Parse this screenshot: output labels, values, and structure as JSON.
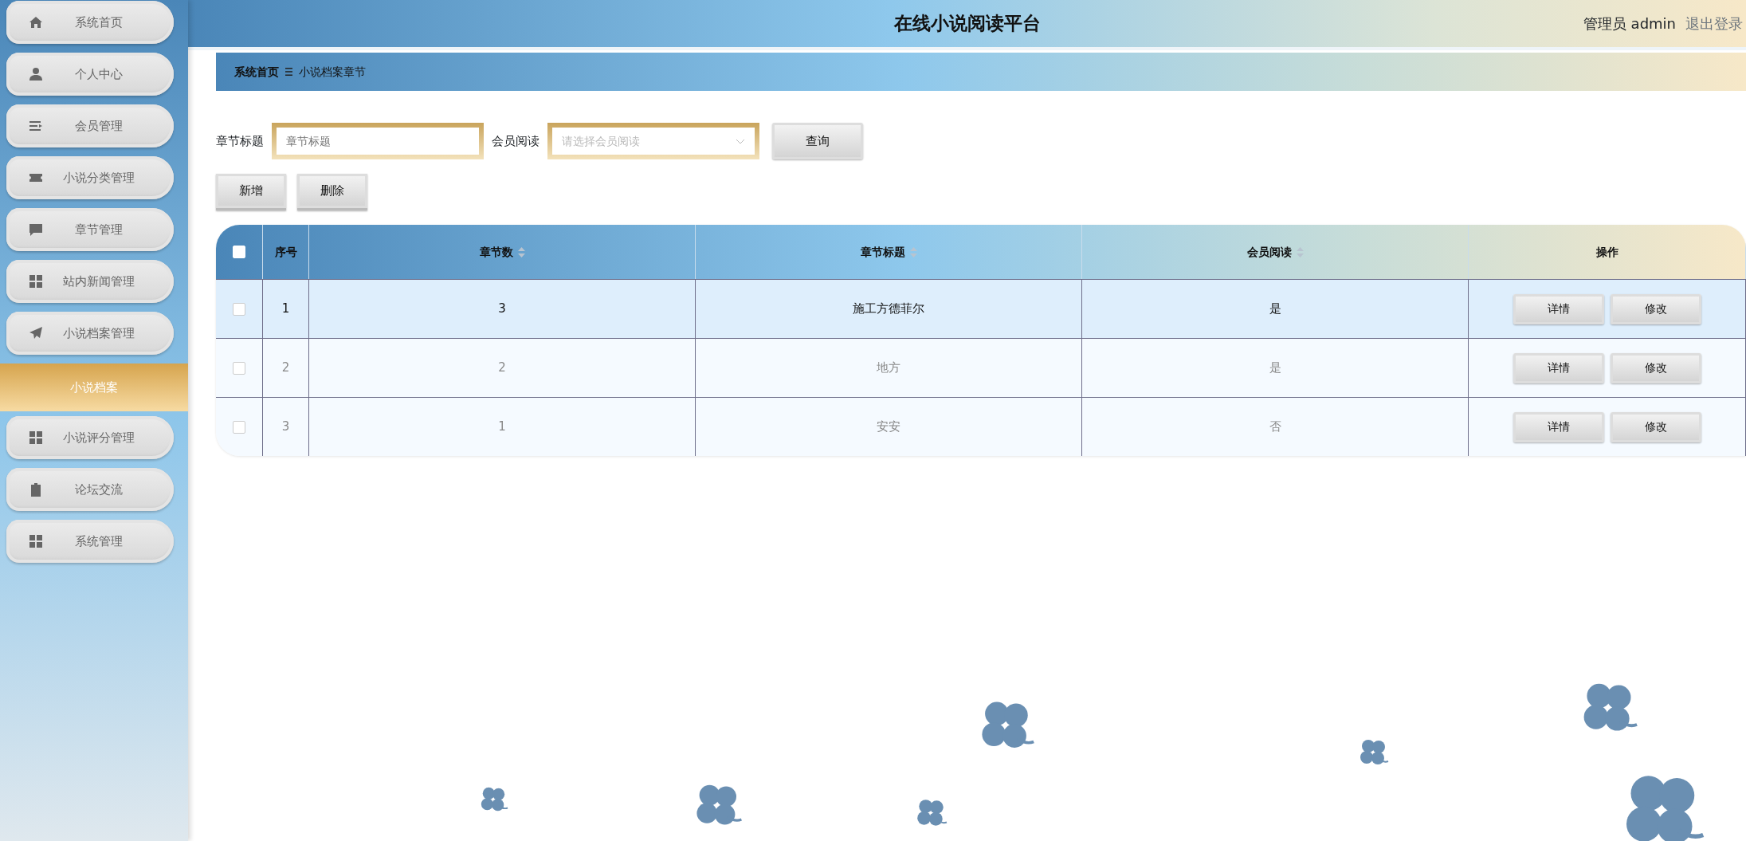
{
  "sidebar": {
    "items": [
      {
        "label": "系统首页",
        "selected": false
      },
      {
        "label": "个人中心",
        "selected": false
      },
      {
        "label": "会员管理",
        "selected": false
      },
      {
        "label": "小说分类管理",
        "selected": false
      },
      {
        "label": "章节管理",
        "selected": false
      },
      {
        "label": "站内新闻管理",
        "selected": false
      },
      {
        "label": "小说档案管理",
        "selected": false,
        "children": [
          {
            "label": "小说档案",
            "selected": true
          }
        ]
      },
      {
        "label": "小说评分管理",
        "selected": false
      },
      {
        "label": "论坛交流",
        "selected": false
      },
      {
        "label": "系统管理",
        "selected": false
      }
    ]
  },
  "header": {
    "title": "在线小说阅读平台",
    "user": "管理员 admin",
    "logout": "退出登录"
  },
  "breadcrumb": [
    "系统首页",
    "小说档案章节"
  ],
  "search": {
    "fields": [
      {
        "label": "章节标题",
        "kind": "input",
        "placeholder": "章节标题"
      },
      {
        "label": "会员阅读",
        "kind": "select",
        "placeholder": "请选择会员阅读"
      }
    ],
    "button": "查询"
  },
  "actions": [
    "新增",
    "删除"
  ],
  "table": {
    "select_all_checked": false,
    "columns": [
      {
        "label": "序号",
        "sortable": false
      },
      {
        "label": "章节数",
        "sortable": true
      },
      {
        "label": "章节标题",
        "sortable": true
      },
      {
        "label": "会员阅读",
        "sortable": true
      },
      {
        "label": "操作",
        "sortable": false
      }
    ],
    "rows": [
      {
        "checked": false,
        "highlighted": true,
        "cells": [
          "1",
          "3",
          "施工方德菲尔",
          "是"
        ],
        "buttons": [
          "详情",
          "修改"
        ]
      },
      {
        "checked": false,
        "highlighted": false,
        "cells": [
          "2",
          "2",
          "地方",
          "是"
        ],
        "buttons": [
          "详情",
          "修改"
        ]
      },
      {
        "checked": false,
        "highlighted": false,
        "cells": [
          "3",
          "1",
          "安安",
          "否"
        ],
        "buttons": [
          "详情",
          "修改"
        ]
      }
    ]
  }
}
